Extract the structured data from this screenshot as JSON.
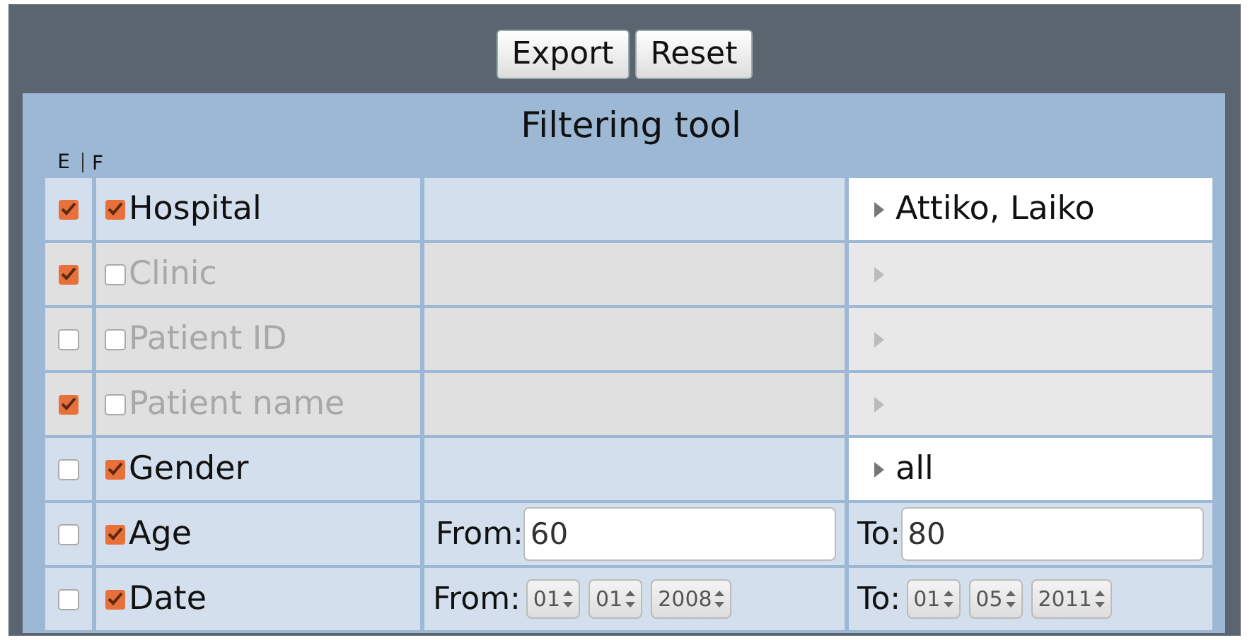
{
  "toolbar": {
    "buttons": [
      "Export",
      "Reset"
    ]
  },
  "panel": {
    "title": "Filtering tool",
    "columns": [
      "E",
      "F"
    ]
  },
  "rows": [
    {
      "kind": "select",
      "label": "Hospital",
      "exported": true,
      "filtered": true,
      "value": "Attiko, Laiko"
    },
    {
      "kind": "select",
      "label": "Clinic",
      "exported": true,
      "filtered": false
    },
    {
      "kind": "select",
      "label": "Patient ID",
      "exported": false,
      "filtered": false
    },
    {
      "kind": "select",
      "label": "Patient name",
      "exported": true,
      "filtered": false
    },
    {
      "kind": "select",
      "label": "Gender",
      "exported": false,
      "filtered": true,
      "value": "all"
    },
    {
      "kind": "range",
      "label": "Age",
      "exported": false,
      "filtered": true,
      "from_label": "From:",
      "from": "60",
      "to_label": "To:",
      "to": "80"
    },
    {
      "kind": "date",
      "label": "Date",
      "exported": false,
      "filtered": true,
      "from_label": "From:",
      "from_parts": [
        "01",
        "01",
        "2008"
      ],
      "to_label": "To:",
      "to_parts": [
        "01",
        "05",
        "2011"
      ]
    }
  ]
}
